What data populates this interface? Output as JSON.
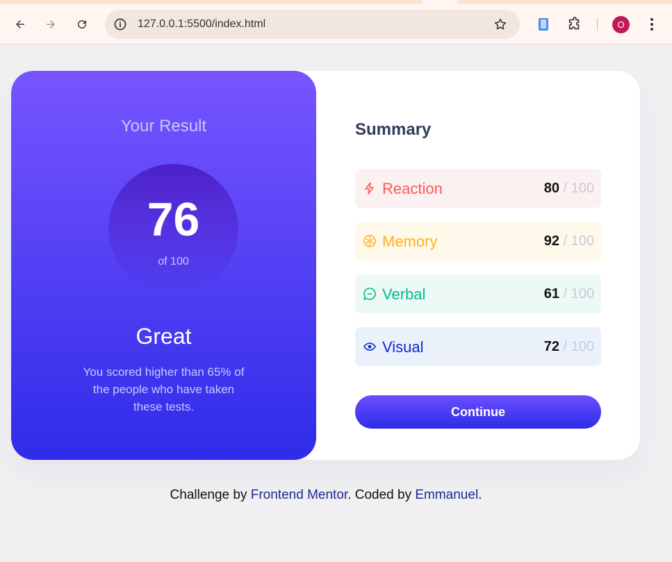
{
  "browser": {
    "url": "127.0.0.1:5500/index.html",
    "profile_initial": "O"
  },
  "result": {
    "title": "Your Result",
    "score": "76",
    "of_label": "of 100",
    "rating": "Great",
    "description": "You scored higher than 65% of the people who have taken these tests."
  },
  "summary": {
    "title": "Summary",
    "items": [
      {
        "label": "Reaction",
        "score": "80",
        "max": " / 100",
        "color": "#ff5757",
        "bg": "#fcf1f1",
        "icon": "lightning-icon"
      },
      {
        "label": "Memory",
        "score": "92",
        "max": " / 100",
        "color": "#ffb01f",
        "bg": "#fff9ec",
        "icon": "brain-icon"
      },
      {
        "label": "Verbal",
        "score": "61",
        "max": " / 100",
        "color": "#00bb8f",
        "bg": "#ecf9f5",
        "icon": "chat-icon"
      },
      {
        "label": "Visual",
        "score": "72",
        "max": " / 100",
        "color": "#1125d6",
        "bg": "#eaf1fb",
        "icon": "eye-icon"
      }
    ],
    "continue_label": "Continue"
  },
  "footer": {
    "prefix": "Challenge by ",
    "link1": "Frontend Mentor",
    "middle": ". Coded by ",
    "link2": "Emmanuel",
    "suffix": "."
  }
}
